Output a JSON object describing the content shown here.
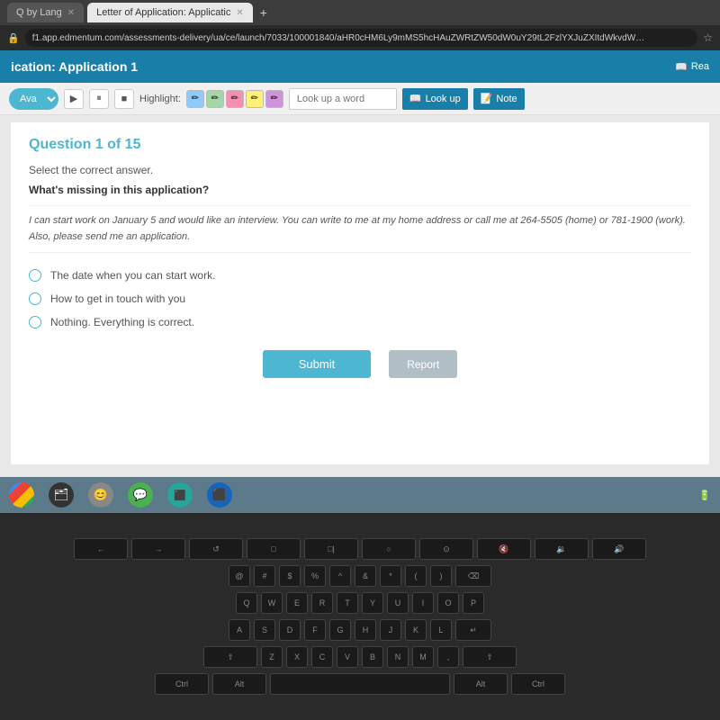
{
  "browser": {
    "tabs": [
      {
        "id": "tab1",
        "label": "Q by Lang",
        "active": false
      },
      {
        "id": "tab2",
        "label": "Letter of Application: Applicatic",
        "active": true
      }
    ],
    "address": "f1.app.edmentum.com/assessments-delivery/ua/ce/launch/7033/100001840/aHR0cHM6Ly9mMS5hcHAuZWRtZW50dW0uY29tL2FzlYXJuZXItdWkvdW…",
    "add_tab": "+"
  },
  "app": {
    "title": "ication: Application 1",
    "read_label": "Rea"
  },
  "toolbar": {
    "avatar": "Ava",
    "highlight_label": "Highlight:",
    "lookup_placeholder": "Look up a word",
    "lookup_btn": "Look up",
    "note_btn": "Note"
  },
  "question": {
    "title": "Question 1 of 15",
    "instruction": "Select the correct answer.",
    "prompt": "What's missing in this application?",
    "passage": "I can start work on January 5 and would like an interview. You can write to me at my home address or call me at 264-5505 (home) or 781-1900 (work). Also, please send me an application.",
    "options": [
      {
        "id": "opt1",
        "text": "The date when you can start work."
      },
      {
        "id": "opt2",
        "text": "How to get in touch with you"
      },
      {
        "id": "opt3",
        "text": "Nothing. Everything is correct."
      }
    ],
    "submit_btn": "Submit",
    "report_btn": "Report"
  },
  "taskbar": {
    "icons": [
      {
        "name": "chrome-icon",
        "type": "chrome"
      },
      {
        "name": "files-icon",
        "type": "dark",
        "symbol": "📁"
      },
      {
        "name": "user-icon",
        "type": "gray",
        "symbol": "👤"
      },
      {
        "name": "chat-icon",
        "type": "green",
        "symbol": "💬"
      },
      {
        "name": "app-icon",
        "type": "teal",
        "symbol": "⬛"
      },
      {
        "name": "settings-icon",
        "type": "blue-dark",
        "symbol": "⚙"
      }
    ]
  },
  "keyboard": {
    "rows": [
      [
        "←",
        "→",
        "↑",
        "C",
        "□",
        "□ |",
        "○",
        "◎",
        "🔊",
        "🔆"
      ],
      [
        "@",
        "#",
        "$",
        "%",
        "^",
        "&",
        "*",
        "(",
        ")",
        "⌫"
      ],
      [
        "Q",
        "W",
        "E",
        "R",
        "T",
        "Y",
        "U",
        "I",
        "O",
        "P"
      ],
      [
        "A",
        "S",
        "D",
        "F",
        "G",
        "H",
        "J",
        "K",
        "L",
        "↵"
      ],
      [
        "Z",
        "X",
        "C",
        "V",
        "B",
        "N",
        "M",
        ",",
        ".",
        "/"
      ],
      [
        "Ctrl",
        "Alt",
        " ",
        "Alt",
        "Ctrl"
      ]
    ]
  }
}
